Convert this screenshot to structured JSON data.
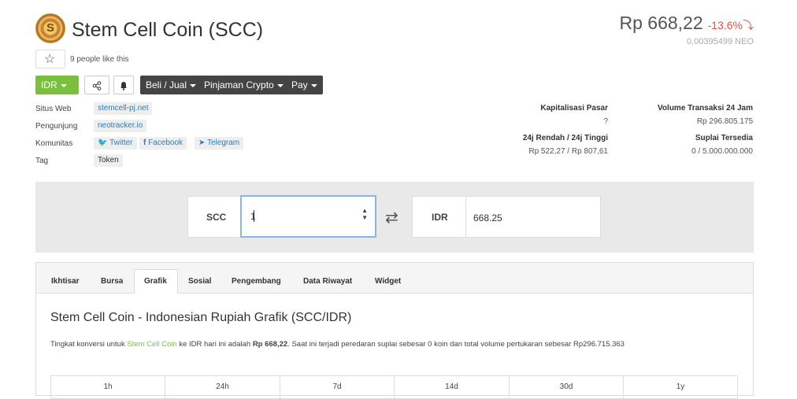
{
  "coin": {
    "name": "Stem Cell Coin (SCC)",
    "logo_letter": "S"
  },
  "price": {
    "value": "Rp 668,22",
    "change": "-13.6%",
    "change_arrow": "⤵",
    "neo": "0,00395499 NEO"
  },
  "likes": {
    "text": "9 people like this"
  },
  "toolbar": {
    "currency": "IDR",
    "share_icon": "share-icon",
    "bell_icon": "bell-icon",
    "buy_sell": "Beli / Jual",
    "loan": "Pinjaman Crypto",
    "pay": "Pay"
  },
  "info": {
    "website_label": "Situs Web",
    "website": "stemcell-pj.net",
    "explorer_label": "Pengunjung",
    "explorer": "neotracker.io",
    "community_label": "Komunitas",
    "twitter": "Twitter",
    "facebook": "Facebook",
    "telegram": "Telegram",
    "tag_label": "Tag",
    "tag": "Token"
  },
  "stats": {
    "market_cap_label": "Kapitalisasi Pasar",
    "market_cap": "?",
    "volume_label": "Volume Transaksi 24 Jam",
    "volume": "Rp 296.805.175",
    "range_label": "24j Rendah / 24j Tinggi",
    "range": "Rp 522,27 / Rp 807,61",
    "supply_label": "Suplai Tersedia",
    "supply": "0 / 5.000.000.000"
  },
  "converter": {
    "from": "SCC",
    "from_value": "1",
    "to": "IDR",
    "to_value": "668.25",
    "swap_icon": "swap-arrows-icon"
  },
  "tabs": [
    "Ikhtisar",
    "Bursa",
    "Grafik",
    "Sosial",
    "Pengembang",
    "Data Riwayat",
    "Widget"
  ],
  "active_tab": "Grafik",
  "content": {
    "heading": "Stem Cell Coin - Indonesian Rupiah Grafik (SCC/IDR)",
    "desc_1": "Tingkat konversi untuk ",
    "desc_link": "Stem Cell Coin",
    "desc_2": " ke IDR hari ini adalah ",
    "desc_price": "Rp 668,22",
    "desc_3": ". Saat ini terjadi peredaran suplai sebesar 0 koin dan total volume pertukaran sebesar Rp296.715.363"
  },
  "ranges": [
    "1h",
    "24h",
    "7d",
    "14d",
    "30d",
    "1y"
  ],
  "colors": {
    "accent": "#7bbf3f",
    "dark_button": "#444444",
    "negative": "#d9534f",
    "link": "#2a7fba"
  }
}
